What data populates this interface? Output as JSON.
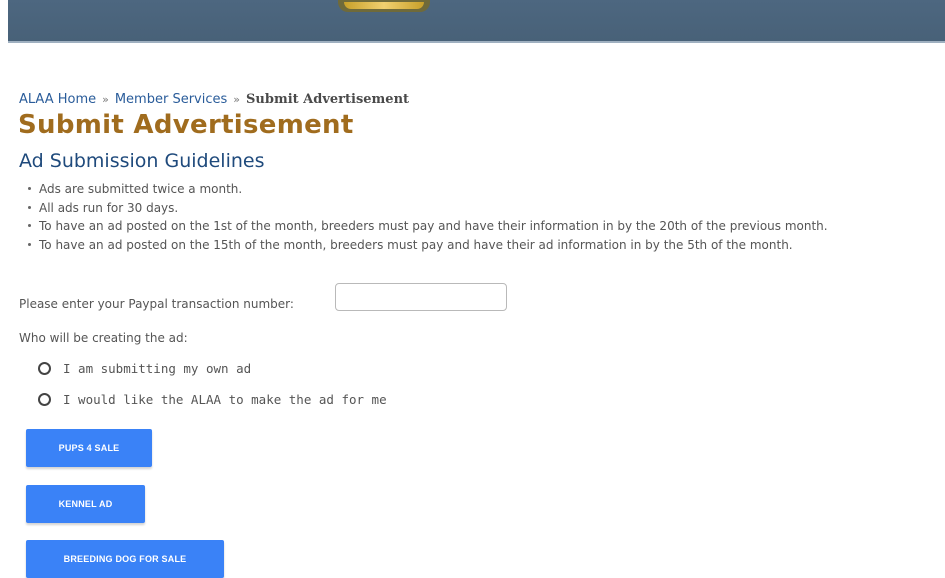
{
  "breadcrumb": {
    "home": "ALAA Home",
    "separator": "»",
    "member_services": "Member Services",
    "current": "Submit Advertisement"
  },
  "page_title": "Submit Advertisement",
  "section_heading": "Ad Submission Guidelines",
  "guidelines": [
    "Ads are submitted twice a month.",
    "All ads run for 30 days.",
    "To have an ad posted on the 1st of the month, breeders must pay and have their information in by the 20th of the previous month.",
    "To have an ad posted on the 15th of the month, breeders must pay and have their ad information in by the 5th of the month."
  ],
  "paypal": {
    "label": "Please enter your Paypal transaction number:",
    "value": ""
  },
  "who_creates": {
    "label": "Who will be creating the ad:",
    "options": [
      "I am submitting my own ad",
      "I would like the ALAA to make the ad for me"
    ]
  },
  "buttons": {
    "pups": "PUPS 4 SALE",
    "kennel": "KENNEL AD",
    "breeding": "BREEDING DOG FOR SALE"
  },
  "colors": {
    "header": "#4d6780",
    "title": "#a06c1e",
    "heading": "#1f4a7c",
    "link": "#2a5c9a",
    "button": "#3a82f7"
  }
}
